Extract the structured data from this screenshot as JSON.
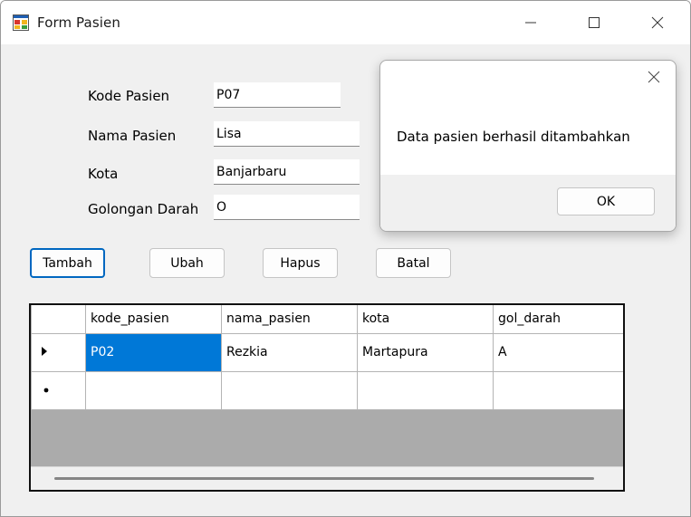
{
  "window": {
    "title": "Form Pasien",
    "icons": [
      "app-form-icon",
      "minimize-icon",
      "maximize-icon",
      "close-icon"
    ]
  },
  "form": {
    "kode_label": "Kode Pasien",
    "kode_value": "P07",
    "nama_label": "Nama Pasien",
    "nama_value": "Lisa",
    "kota_label": "Kota",
    "kota_value": "Banjarbaru",
    "gol_label": "Golongan Darah",
    "gol_value": "O"
  },
  "buttons": {
    "tambah": "Tambah",
    "ubah": "Ubah",
    "hapus": "Hapus",
    "batal": "Batal"
  },
  "grid": {
    "columns": [
      "kode_pasien",
      "nama_pasien",
      "kota",
      "gol_darah"
    ],
    "rows": [
      {
        "kode_pasien": "P02",
        "nama_pasien": "Rezkia",
        "kota": "Martapura",
        "gol_darah": "A"
      }
    ],
    "selection_color": "#0078d7"
  },
  "messagebox": {
    "text": "Data pasien berhasil ditambahkan",
    "ok_label": "OK"
  },
  "colors": {
    "focus_border": "#0067c0",
    "grid_background": "#ababab",
    "form_background": "#f0f0f0"
  }
}
